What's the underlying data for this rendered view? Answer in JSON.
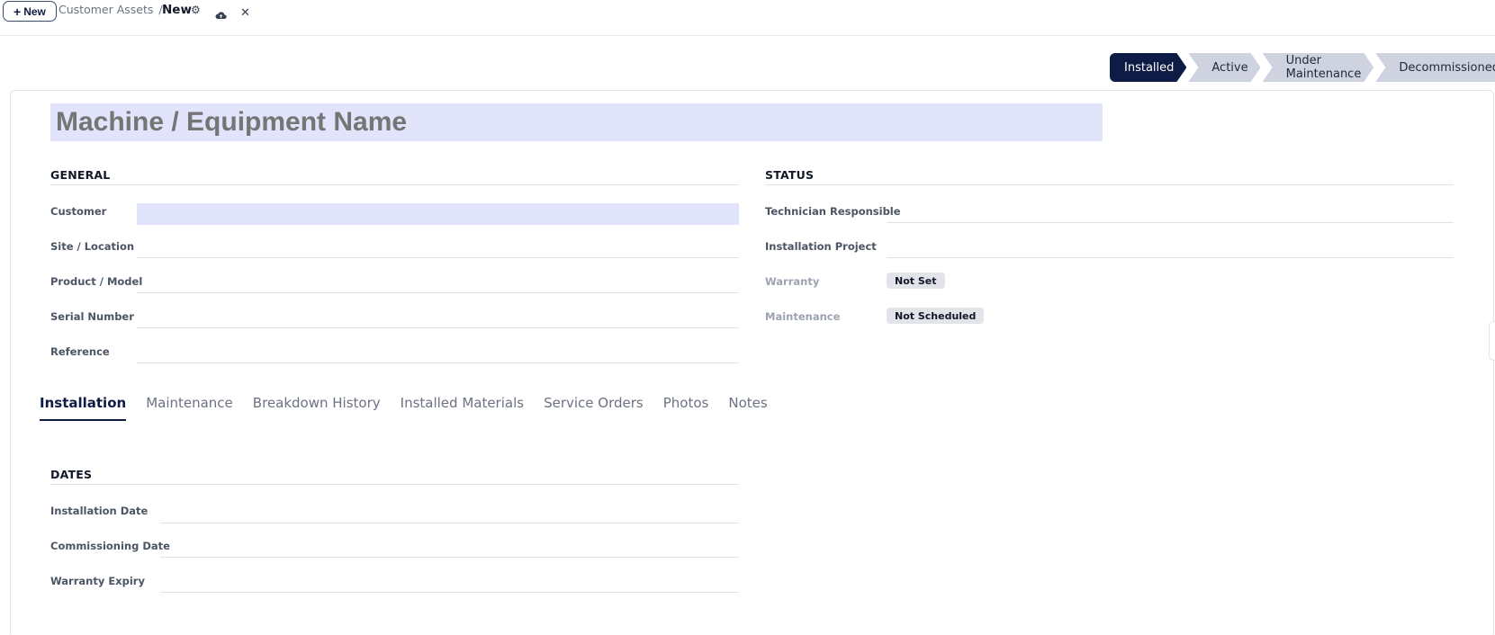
{
  "toolbar": {
    "new_label": "New",
    "breadcrumb_parent": "Customer Assets",
    "breadcrumb_sep": "/",
    "breadcrumb_current": "New"
  },
  "status_bar": {
    "stages": [
      "Installed",
      "Active",
      "Under Maintenance",
      "Decommissioned"
    ],
    "active_stage": "Installed",
    "active_color": "#0d1b45"
  },
  "form": {
    "name_placeholder": "Machine / Equipment Name",
    "general": {
      "title": "GENERAL",
      "fields": [
        "Customer",
        "Site / Location",
        "Product / Model",
        "Serial Number",
        "Reference"
      ]
    },
    "status": {
      "title": "STATUS",
      "technician_label": "Technician Responsible",
      "project_label": "Installation Project",
      "warranty_label": "Warranty",
      "warranty_value": "Not Set",
      "maintenance_label": "Maintenance",
      "maintenance_value": "Not Scheduled"
    },
    "tabs": [
      "Installation",
      "Maintenance",
      "Breakdown History",
      "Installed Materials",
      "Service Orders",
      "Photos",
      "Notes"
    ],
    "active_tab": "Installation",
    "dates": {
      "title": "DATES",
      "fields": [
        "Installation Date",
        "Commissioning Date",
        "Warranty Expiry"
      ]
    }
  },
  "icons": [
    "plus-icon",
    "gear-icon",
    "cloud-upload-icon",
    "close-icon"
  ]
}
